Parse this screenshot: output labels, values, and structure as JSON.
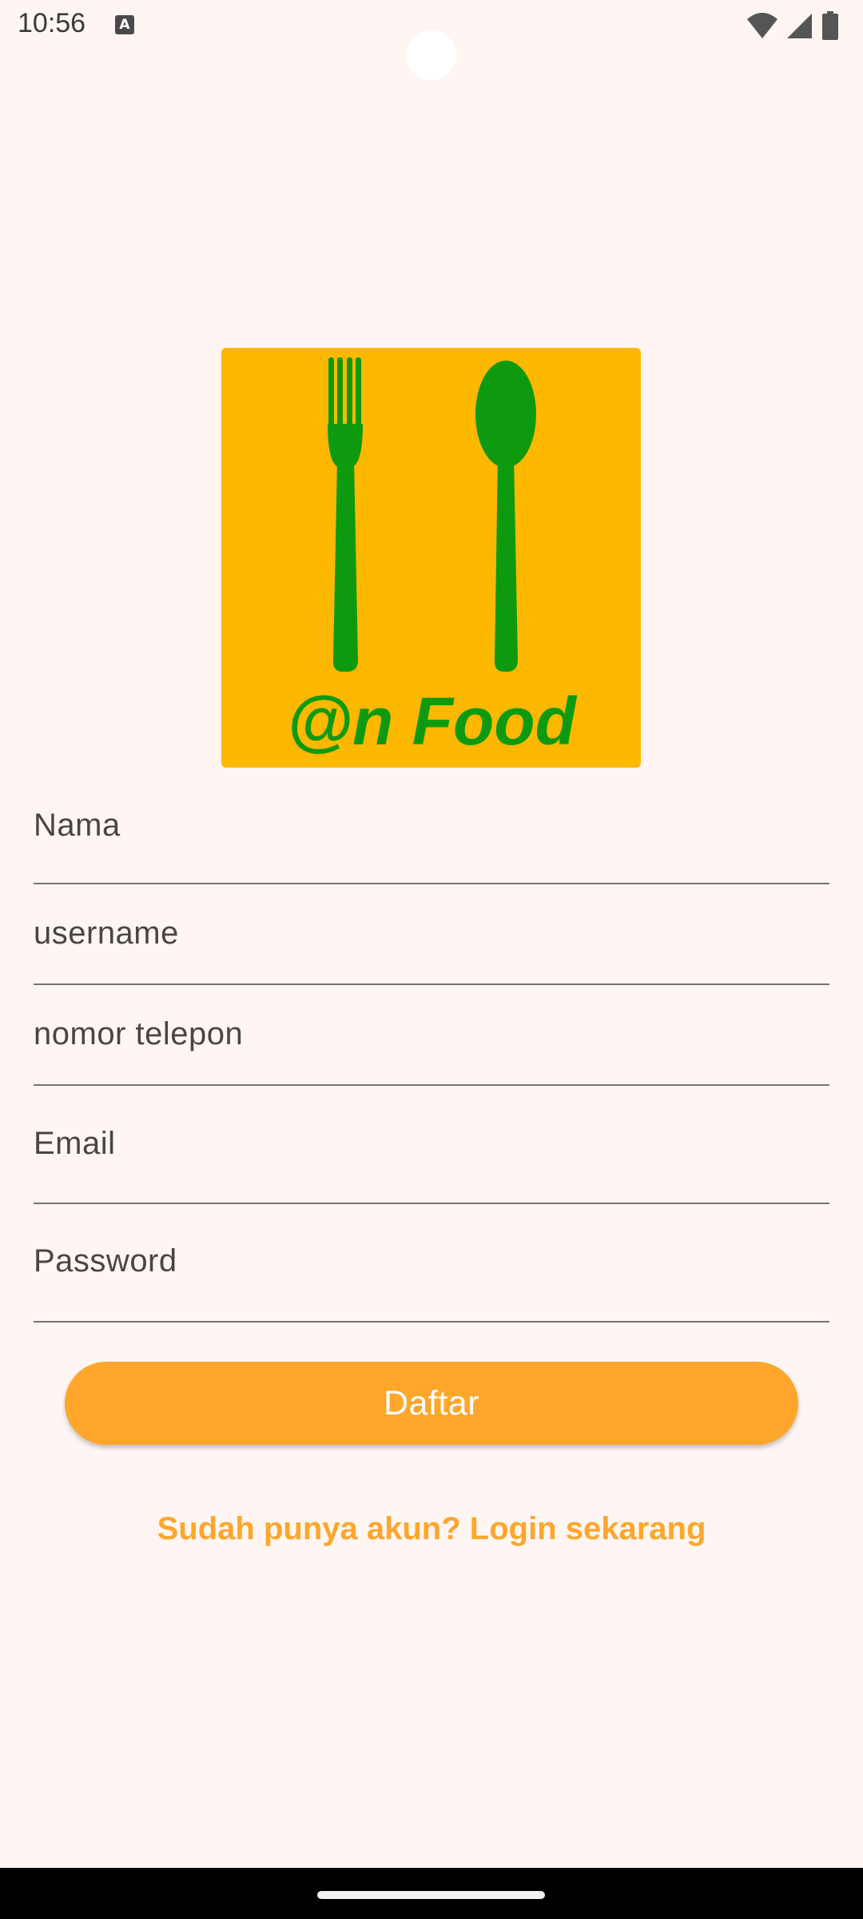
{
  "status_bar": {
    "time": "10:56",
    "notification_icon": "a-icon",
    "icons": [
      "wifi-icon",
      "signal-icon",
      "battery-icon"
    ]
  },
  "logo": {
    "brand_text": "@n Food",
    "icons": [
      "fork-icon",
      "spoon-icon"
    ],
    "colors": {
      "background": "#FFB800",
      "foreground": "#0E9A0E"
    }
  },
  "form": {
    "fields": [
      {
        "label": "Nama"
      },
      {
        "label": "username"
      },
      {
        "label": "nomor telepon"
      },
      {
        "label": "Email"
      },
      {
        "label": "Password"
      }
    ],
    "submit_label": "Daftar",
    "login_link": "Sudah punya akun? Login sekarang"
  },
  "colors": {
    "page_background": "#FFF6F4",
    "accent": "#FFA62B"
  }
}
